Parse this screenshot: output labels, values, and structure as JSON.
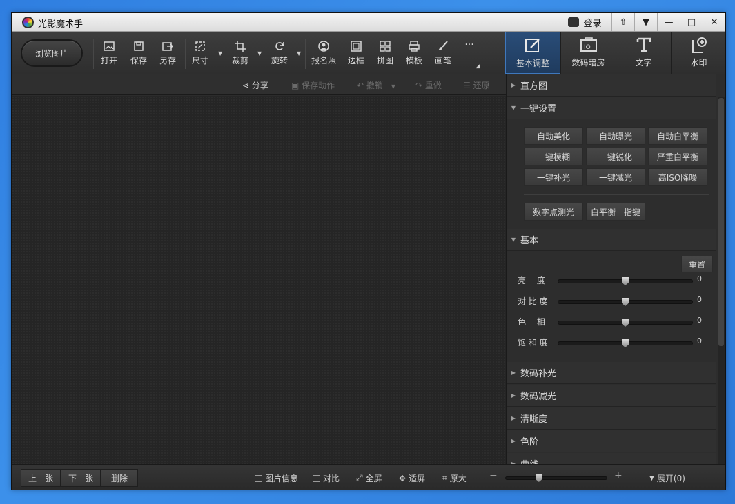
{
  "window": {
    "title": "光影魔术手",
    "login_label": "登录"
  },
  "toolbar": {
    "browse_label": "浏览图片",
    "tools": [
      {
        "id": "open",
        "label": "打开",
        "icon": "open-image-icon"
      },
      {
        "id": "save",
        "label": "保存",
        "icon": "save-icon"
      },
      {
        "id": "saveas",
        "label": "另存",
        "icon": "save-as-icon"
      },
      {
        "id": "size",
        "label": "尺寸",
        "icon": "resize-icon"
      },
      {
        "id": "crop",
        "label": "裁剪",
        "icon": "crop-icon"
      },
      {
        "id": "rotate",
        "label": "旋转",
        "icon": "rotate-icon"
      },
      {
        "id": "idphoto",
        "label": "报名照",
        "icon": "id-photo-icon"
      },
      {
        "id": "border",
        "label": "边框",
        "icon": "border-icon"
      },
      {
        "id": "collage",
        "label": "拼图",
        "icon": "collage-icon"
      },
      {
        "id": "template",
        "label": "模板",
        "icon": "template-icon"
      },
      {
        "id": "brush",
        "label": "画笔",
        "icon": "brush-icon"
      },
      {
        "id": "more",
        "label": "···",
        "icon": "more-icon"
      }
    ],
    "right_tabs": [
      {
        "label": "基本调整",
        "icon": "basic-adjust-icon",
        "active": true
      },
      {
        "label": "数码暗房",
        "icon": "darkroom-icon",
        "active": false
      },
      {
        "label": "文字",
        "icon": "text-icon",
        "active": false
      },
      {
        "label": "水印",
        "icon": "watermark-icon",
        "active": false
      }
    ]
  },
  "editbar": {
    "share": "分享",
    "save_action": "保存动作",
    "undo": "撤销",
    "redo": "重做",
    "restore": "还原"
  },
  "panel": {
    "histogram": "直方图",
    "oneclick": {
      "title": "一键设置",
      "buttons": [
        "自动美化",
        "自动曝光",
        "自动白平衡",
        "一键模糊",
        "一键锐化",
        "严重白平衡",
        "一键补光",
        "一键减光",
        "高ISO降噪"
      ],
      "extra": [
        "数字点测光",
        "白平衡一指键"
      ]
    },
    "basic": {
      "title": "基本",
      "reset": "重置",
      "sliders": [
        {
          "label": "亮　 度",
          "value": "0",
          "level": 0.5
        },
        {
          "label": "对 比 度",
          "value": "0",
          "level": 0.5
        },
        {
          "label": "色　 相",
          "value": "0",
          "level": 0.5
        },
        {
          "label": "饱 和 度",
          "value": "0",
          "level": 0.5
        }
      ]
    },
    "sections": [
      "数码补光",
      "数码减光",
      "清晰度",
      "色阶",
      "曲线"
    ]
  },
  "statusbar": {
    "prev": "上一张",
    "next": "下一张",
    "delete": "删除",
    "info": "图片信息",
    "compare": "对比",
    "fullscreen": "全屏",
    "fit": "适屏",
    "original": "原大",
    "expand": "展开(0)",
    "zoom_level": 0.33
  }
}
